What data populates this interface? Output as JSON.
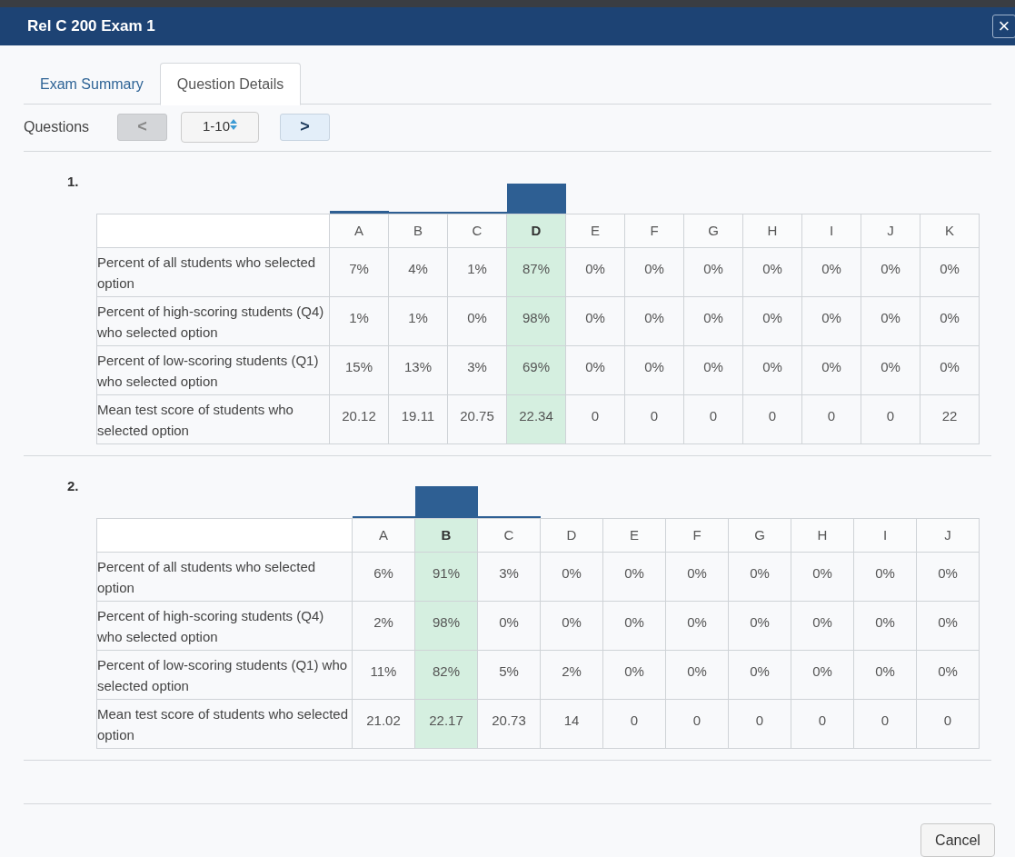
{
  "window": {
    "title": "Rel C 200 Exam 1",
    "close": "×"
  },
  "tabs": [
    {
      "label": "Exam Summary",
      "selected": false
    },
    {
      "label": "Question Details",
      "selected": true
    }
  ],
  "pager": {
    "label": "Questions",
    "prev": "<",
    "range": "1-10",
    "next": ">",
    "prev_disabled": true
  },
  "questions": [
    {
      "number": "1.",
      "options": [
        {
          "label": "A",
          "selected": false
        },
        {
          "label": "B",
          "selected": false
        },
        {
          "label": "C",
          "selected": false
        },
        {
          "label": "D",
          "selected": true
        },
        {
          "label": "E",
          "selected": false
        },
        {
          "label": "F",
          "selected": false
        },
        {
          "label": "G",
          "selected": false
        },
        {
          "label": "H",
          "selected": false
        },
        {
          "label": "I",
          "selected": false
        },
        {
          "label": "J",
          "selected": false
        },
        {
          "label": "K",
          "selected": false
        }
      ],
      "rows": [
        {
          "label": "Percent of all students who selected option",
          "values": [
            "7%",
            "4%",
            "1%",
            "87%",
            "0%",
            "0%",
            "0%",
            "0%",
            "0%",
            "0%",
            "0%"
          ]
        },
        {
          "label": "Percent of high-scoring students (Q4) who selected option",
          "values": [
            "1%",
            "1%",
            "0%",
            "98%",
            "0%",
            "0%",
            "0%",
            "0%",
            "0%",
            "0%",
            "0%"
          ]
        },
        {
          "label": "Percent of low-scoring students (Q1) who selected option",
          "values": [
            "15%",
            "13%",
            "3%",
            "69%",
            "0%",
            "0%",
            "0%",
            "0%",
            "0%",
            "0%",
            "0%"
          ]
        },
        {
          "label": "Mean test score of students who selected option",
          "values": [
            "20.12",
            "19.11",
            "20.75",
            "22.34",
            "0",
            "0",
            "0",
            "0",
            "0",
            "0",
            "22"
          ]
        }
      ]
    },
    {
      "number": "2.",
      "options": [
        {
          "label": "A",
          "selected": false
        },
        {
          "label": "B",
          "selected": true
        },
        {
          "label": "C",
          "selected": false
        },
        {
          "label": "D",
          "selected": false
        },
        {
          "label": "E",
          "selected": false
        },
        {
          "label": "F",
          "selected": false
        },
        {
          "label": "G",
          "selected": false
        },
        {
          "label": "H",
          "selected": false
        },
        {
          "label": "I",
          "selected": false
        },
        {
          "label": "J",
          "selected": false
        }
      ],
      "rows": [
        {
          "label": "Percent of all students who selected option",
          "values": [
            "6%",
            "91%",
            "3%",
            "0%",
            "0%",
            "0%",
            "0%",
            "0%",
            "0%",
            "0%"
          ]
        },
        {
          "label": "Percent of high-scoring students (Q4) who selected option",
          "values": [
            "2%",
            "98%",
            "0%",
            "0%",
            "0%",
            "0%",
            "0%",
            "0%",
            "0%",
            "0%"
          ]
        },
        {
          "label": "Percent of low-scoring students (Q1) who selected option",
          "values": [
            "11%",
            "82%",
            "5%",
            "2%",
            "0%",
            "0%",
            "0%",
            "0%",
            "0%",
            "0%"
          ]
        },
        {
          "label": "Mean test score of students who selected option",
          "values": [
            "21.02",
            "22.17",
            "20.73",
            "14",
            "0",
            "0",
            "0",
            "0",
            "0",
            "0"
          ]
        }
      ]
    }
  ],
  "footer": {
    "cancel": "Cancel"
  }
}
